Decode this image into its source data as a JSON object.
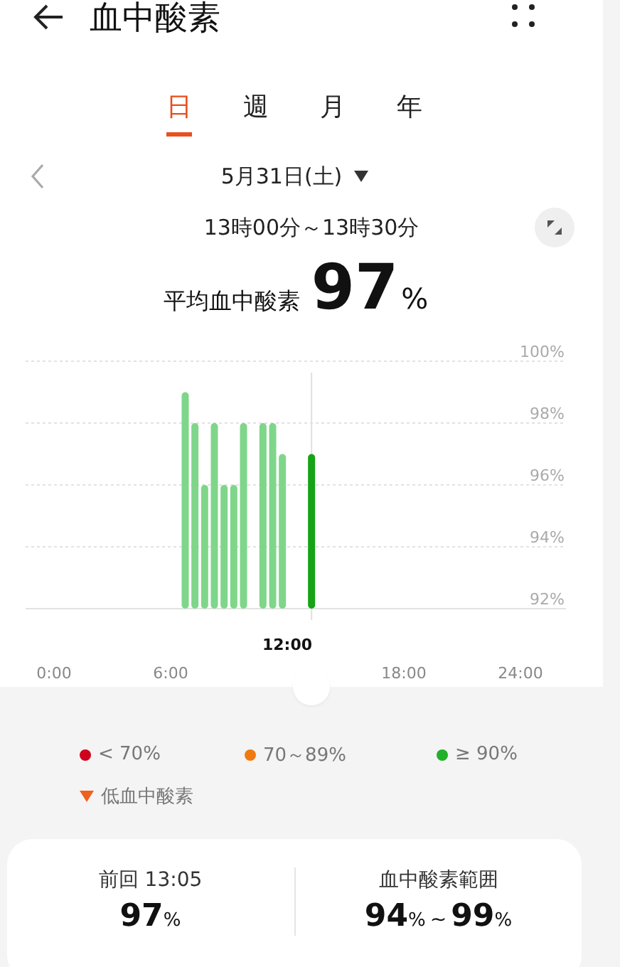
{
  "header": {
    "title": "血中酸素"
  },
  "tabs": [
    {
      "label": "日",
      "selected": true
    },
    {
      "label": "週",
      "selected": false
    },
    {
      "label": "月",
      "selected": false
    },
    {
      "label": "年",
      "selected": false
    }
  ],
  "date": {
    "label": "5月31日(土)"
  },
  "time_range": "13時00分～13時30分",
  "average": {
    "label": "平均血中酸素",
    "value": "97",
    "unit": "%"
  },
  "chart_data": {
    "type": "bar",
    "x": [
      6.75,
      7.25,
      7.75,
      8.25,
      8.75,
      9.25,
      9.75,
      10.75,
      11.25,
      11.75,
      13.25
    ],
    "series": [
      {
        "color": "#7fd68a",
        "values": [
          99,
          98,
          96,
          98,
          96,
          96,
          98,
          98,
          98,
          97,
          null
        ]
      },
      {
        "color": "#16a316",
        "values": [
          null,
          null,
          null,
          null,
          null,
          null,
          null,
          null,
          null,
          null,
          97
        ]
      }
    ],
    "xlim": [
      0,
      24
    ],
    "ylim": [
      92,
      100
    ],
    "grid": true,
    "xticks": [
      {
        "value": 0,
        "label": "0:00"
      },
      {
        "value": 6,
        "label": "6:00"
      },
      {
        "value": 18,
        "label": "18:00"
      },
      {
        "value": 24,
        "label": "24:00"
      }
    ],
    "annotations": [
      "12:00"
    ],
    "ref_lines": [
      {
        "axis": "x",
        "value": 13.25,
        "color": "#e0e0e0"
      }
    ],
    "yticks": [
      {
        "value": 100,
        "label": "100%"
      },
      {
        "value": 98,
        "label": "98%"
      },
      {
        "value": 96,
        "label": "96%"
      },
      {
        "value": 94,
        "label": "94%"
      },
      {
        "value": 92,
        "label": "92%"
      }
    ]
  },
  "legend": [
    {
      "kind": "dot",
      "color": "#d0021b",
      "label": "< 70%"
    },
    {
      "kind": "dot",
      "color": "#f07a10",
      "label": "70～89%"
    },
    {
      "kind": "dot",
      "color": "#22b02a",
      "label": "≥ 90%"
    },
    {
      "kind": "triangle",
      "color": "#f0601e",
      "label": "低血中酸素"
    }
  ],
  "summary": [
    {
      "label": "前回 13:05",
      "values": [
        {
          "value": "97",
          "unit": "%"
        }
      ]
    },
    {
      "label": "血中酸素範囲",
      "separator": "~",
      "values": [
        {
          "value": "94",
          "unit": "%"
        },
        {
          "value": "99",
          "unit": "%"
        }
      ]
    }
  ]
}
